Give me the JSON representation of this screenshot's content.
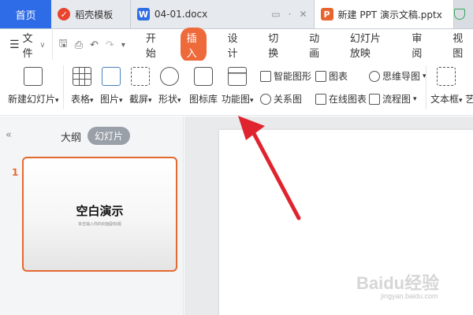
{
  "tabs": {
    "home": "首页",
    "docer": "稻壳模板",
    "docx": "04-01.docx",
    "pptx": "新建 PPT 演示文稿.pptx"
  },
  "menu": {
    "file": "文件",
    "tabs": [
      "开始",
      "插入",
      "设计",
      "切换",
      "动画",
      "幻灯片放映",
      "审阅",
      "视图"
    ],
    "active_tab": "插入"
  },
  "ribbon": {
    "new_slide": "新建幻灯片",
    "table": "表格",
    "picture": "图片",
    "screenshot": "截屏",
    "shape": "形状",
    "icon_lib": "图标库",
    "function_chart": "功能图",
    "smart_art": "智能图形",
    "chart": "图表",
    "relation_chart": "关系图",
    "online_chart": "在线图表",
    "mind_map": "思维导图",
    "flow_chart": "流程图",
    "text_box": "文本框",
    "text_box_cut": "艺"
  },
  "panel": {
    "outline": "大纲",
    "slides": "幻灯片",
    "slide_number": "1",
    "thumb_title": "空白演示",
    "thumb_sub": "单击输入你的封面副标题"
  },
  "watermark": {
    "main": "Baidu经验",
    "sub": "jingyan.baidu.com"
  },
  "colors": {
    "home_tab": "#2e6be6",
    "accent": "#ee6a3b",
    "arrow": "#e0242f"
  }
}
